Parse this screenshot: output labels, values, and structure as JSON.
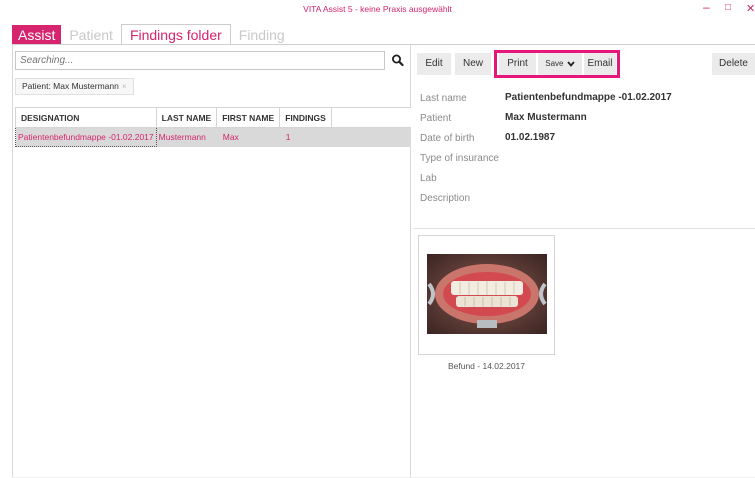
{
  "window": {
    "title": "VITA Assist 5 - keine Praxis ausgewählt",
    "minimize_glyph": "–",
    "maximize_glyph": "□",
    "close_glyph": "✕"
  },
  "tabs": [
    {
      "label": "Assist"
    },
    {
      "label": "Patient"
    },
    {
      "label": "Findings folder"
    },
    {
      "label": "Finding"
    }
  ],
  "search": {
    "placeholder": "Searching...",
    "icon": "search-icon"
  },
  "filter": {
    "label": "Patient: Max Mustermann",
    "remove_glyph": "×"
  },
  "table": {
    "headers": [
      "DESIGNATION",
      "LAST NAME",
      "FIRST NAME",
      "FINDINGS"
    ],
    "rows": [
      {
        "designation": "Patientenbefundmappe -01.02.2017",
        "last_name": "Mustermann",
        "first_name": "Max",
        "findings": "1"
      }
    ]
  },
  "toolbar": {
    "edit": "Edit",
    "new": "New",
    "print": "Print",
    "save": "Save",
    "email": "Email",
    "delete": "Delete"
  },
  "details": [
    {
      "label": "Last name",
      "value": "Patientenbefundmappe -01.02.2017"
    },
    {
      "label": "Patient",
      "value": "Max Mustermann"
    },
    {
      "label": "Date of birth",
      "value": "01.02.1987"
    },
    {
      "label": "Type of insurance",
      "value": ""
    },
    {
      "label": "Lab",
      "value": ""
    },
    {
      "label": "Description",
      "value": ""
    }
  ],
  "finding_thumb": {
    "caption": "Befund - 14.02.2017"
  },
  "colors": {
    "accent": "#d6246e",
    "highlight": "#e6177a"
  }
}
